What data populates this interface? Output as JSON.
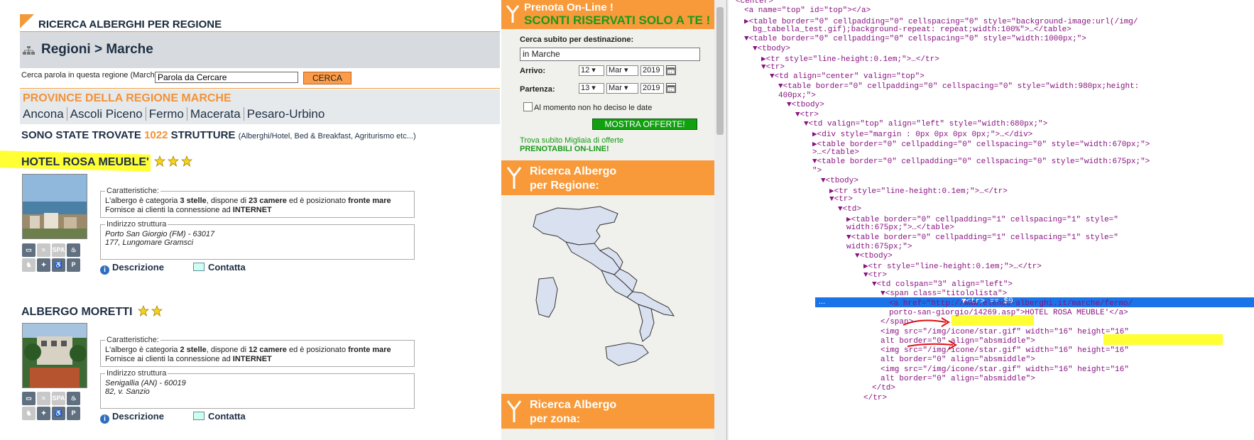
{
  "left": {
    "header_title": "RICERCA ALBERGHI PER REGIONE",
    "breadcrumb": "Regioni > Marche",
    "search_label": "Cerca parola in questa regione (Marche):",
    "search_value": "Parola da Cercare",
    "search_button": "CERCA",
    "provinces_title": "PROVINCE DELLA REGIONE MARCHE",
    "provinces": [
      "Ancona",
      "Ascoli Piceno",
      "Fermo",
      "Macerata",
      "Pesaro-Urbino"
    ],
    "found_prefix": "SONO STATE TROVATE",
    "found_count": "1022",
    "found_suffix": "STRUTTURE",
    "found_note": "(Alberghi/Hotel, Bed & Breakfast, Agriturismo etc...)",
    "hotels": [
      {
        "name": "HOTEL ROSA MEUBLE'",
        "stars": 3,
        "features_legend": "Caratteristiche:",
        "features_line1_a": "L'albergo è categoria ",
        "features_line1_b": "3 stelle",
        "features_line1_c": ", dispone di ",
        "features_line1_d": "23 camere",
        "features_line1_e": " ed è posizionato ",
        "features_line1_f": "fronte mare",
        "features_line2_a": "Fornisce ai clienti la connessione ad ",
        "features_line2_b": "INTERNET",
        "address_legend": "Indirizzo struttura",
        "address_line1": "Porto San Giorgio (FM) - 63017",
        "address_line2": "177, Lungomare Gramsci",
        "desc_link": "Descrizione",
        "contact_link": "Contatta"
      },
      {
        "name": "ALBERGO MORETTI",
        "stars": 2,
        "features_legend": "Caratteristiche:",
        "features_line1_a": "L'albergo è categoria ",
        "features_line1_b": "2 stelle",
        "features_line1_c": ", dispone di ",
        "features_line1_d": "12 camere",
        "features_line1_e": " ed è posizionato ",
        "features_line1_f": "fronte mare",
        "features_line2_a": "Fornisce ai clienti la connessione ad ",
        "features_line2_b": "INTERNET",
        "address_legend": "Indirizzo struttura",
        "address_line1": "Senigallia (AN) - 60019",
        "address_line2": "82, v. Sanzio",
        "desc_link": "Descrizione",
        "contact_link": "Contatta"
      }
    ],
    "service_icon_spa": "SPA",
    "service_icon_p": "P"
  },
  "mid": {
    "promo_line1": "Prenota On-Line !",
    "promo_line2": "SCONTI RISERVATI SOLO A TE !",
    "dest_label": "Cerca subito per destinazione:",
    "dest_value": "in Marche",
    "arrival_label": "Arrivo:",
    "arrival_day": "12",
    "arrival_month": "Mar",
    "arrival_year": "2019",
    "departure_label": "Partenza:",
    "departure_day": "13",
    "departure_month": "Mar",
    "departure_year": "2019",
    "undecided_label": "Al momento non ho deciso le date",
    "show_button": "MOSTRA OFFERTE!",
    "offer_line1": "Trova subito Migliaia di offerte",
    "offer_line2": "PRENOTABILI ON-LINE!",
    "region_box_line1": "Ricerca Albergo",
    "region_box_line2": "per Regione:",
    "zone_box_line1": "Ricerca Albergo",
    "zone_box_line2": "per zona:"
  },
  "dev": {
    "selected_marker": "== $0",
    "ellipsis": "...",
    "lines": [
      {
        "indent": 2,
        "text": "<center>"
      },
      {
        "indent": 3,
        "text": "<a name=\"top\" id=\"top\"></a>"
      },
      {
        "indent": 3,
        "text": "▶<table border=\"0\" cellpadding=\"0\" cellspacing=\"0\" style=\"background-image:url(/img/"
      },
      {
        "indent": 4,
        "text": "bg_tabella_test.gif);background-repeat: repeat;width:100%\">…</table>"
      },
      {
        "indent": 3,
        "text": "▼<table border=\"0\" cellpadding=\"0\" cellspacing=\"0\" style=\"width:1000px;\">"
      },
      {
        "indent": 4,
        "text": "▼<tbody>"
      },
      {
        "indent": 5,
        "text": "▶<tr style=\"line-height:0.1em;\">…</tr>"
      },
      {
        "indent": 5,
        "text": "▼<tr>"
      },
      {
        "indent": 6,
        "text": "▼<td align=\"center\" valign=\"top\">"
      },
      {
        "indent": 7,
        "text": "▼<table border=\"0\" cellpadding=\"0\" cellspacing=\"0\" style=\"width:980px;height:"
      },
      {
        "indent": 7,
        "text": "400px;\">"
      },
      {
        "indent": 8,
        "text": "▼<tbody>"
      },
      {
        "indent": 9,
        "text": "▼<tr>"
      },
      {
        "indent": 10,
        "text": "▼<td valign=\"top\" align=\"left\" style=\"width:680px;\">"
      },
      {
        "indent": 11,
        "text": "▶<div style=\"margin : 0px 0px 0px 0px;\">…</div>"
      },
      {
        "indent": 11,
        "text": "▶<table border=\"0\" cellpadding=\"0\" cellspacing=\"0\" style=\"width:670px;\">"
      },
      {
        "indent": 11,
        "text": ">…</table>"
      },
      {
        "indent": 11,
        "text": "▼<table border=\"0\" cellpadding=\"0\" cellspacing=\"0\" style=\"width:675px;\">"
      },
      {
        "indent": 11,
        "text": "\">"
      },
      {
        "indent": 12,
        "text": "▼<tbody>"
      },
      {
        "indent": 13,
        "text": "▶<tr style=\"line-height:0.1em;\">…</tr>"
      },
      {
        "indent": 13,
        "text": "▼<tr>"
      },
      {
        "indent": 14,
        "text": "▼<td>"
      },
      {
        "indent": 15,
        "text": "▶<table border=\"0\" cellpadding=\"1\" cellspacing=\"1\" style=\""
      },
      {
        "indent": 15,
        "text": "width:675px;\">…</table>"
      },
      {
        "indent": 15,
        "text": "▼<table border=\"0\" cellpadding=\"1\" cellspacing=\"1\" style=\""
      },
      {
        "indent": 15,
        "text": "width:675px;\">"
      },
      {
        "indent": 16,
        "text": "▼<tbody>"
      },
      {
        "indent": 17,
        "text": "▶<tr style=\"line-height:0.1em;\">…</tr>"
      },
      {
        "indent": 17,
        "text": "▼<tr>"
      },
      {
        "indent": 18,
        "text": "▼<td colspan=\"3\" align=\"left\">"
      },
      {
        "indent": 19,
        "text": "▼<span class=\"titololista\">"
      },
      {
        "indent": 20,
        "text": "<a href=\"http://www.elenco-alberghi.it/marche/fermo/"
      },
      {
        "indent": 20,
        "text": "porto-san-giorgio/14269.asp\">HOTEL ROSA MEUBLE'</a>"
      },
      {
        "indent": 19,
        "text": "</span>"
      },
      {
        "indent": 19,
        "text": "<img src=\"/img/icone/star.gif\" width=\"16\" height=\"16\""
      },
      {
        "indent": 19,
        "text": "alt border=\"0\" align=\"absmiddle\">"
      },
      {
        "indent": 19,
        "text": "<img src=\"/img/icone/star.gif\" width=\"16\" height=\"16\""
      },
      {
        "indent": 19,
        "text": "alt border=\"0\" align=\"absmiddle\">"
      },
      {
        "indent": 19,
        "text": "<img src=\"/img/icone/star.gif\" width=\"16\" height=\"16\""
      },
      {
        "indent": 19,
        "text": "alt border=\"0\" align=\"absmiddle\">"
      },
      {
        "indent": 18,
        "text": "</td>"
      },
      {
        "indent": 17,
        "text": "</tr>"
      }
    ]
  }
}
